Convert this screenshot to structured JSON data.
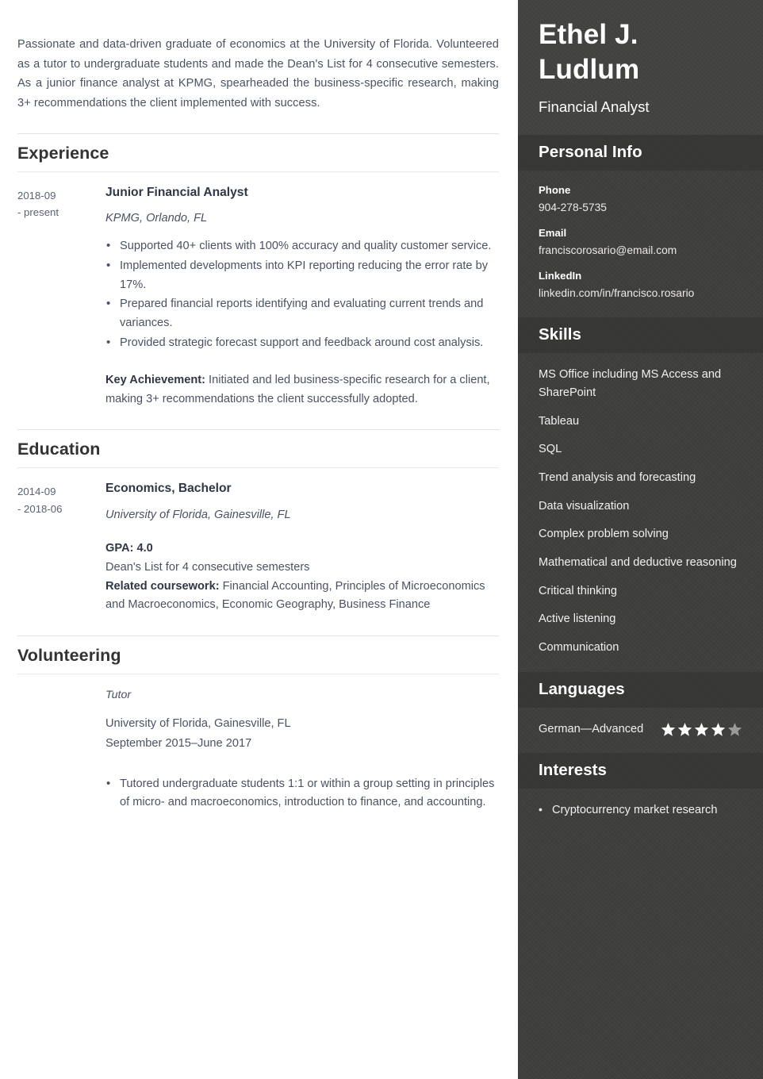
{
  "colors": {
    "sidebar_bg": "#3f3f3d",
    "sidebar_top_bg": "#434341",
    "sidebar_header_bg": "#373735",
    "body_text": "#4a5263",
    "heading_text": "#333333",
    "star_filled": "#ffffff",
    "star_empty": "#9a9a9a"
  },
  "main": {
    "summary": "Passionate and data-driven graduate of economics at the University of Florida. Volunteered as a tutor to undergraduate students and made the Dean's List for 4 consecutive semesters. As a junior finance analyst at KPMG, spearheaded the business-specific research, making 3+ recommendations the client implemented with success.",
    "sections": {
      "experience": {
        "heading": "Experience",
        "entries": [
          {
            "date_start": "2018-09",
            "date_end": "- present",
            "title": "Junior Financial Analyst",
            "subtitle": "KPMG, Orlando, FL",
            "bullets": [
              "Supported 40+ clients with 100% accuracy and quality customer service.",
              "Implemented developments into KPI reporting reducing the error rate by 17%.",
              "Prepared financial reports identifying and evaluating current trends and variances.",
              "Provided strategic forecast support and feedback around cost analysis."
            ],
            "achievement_label": "Key Achievement:",
            "achievement_text": " Initiated and led business-specific research for a client, making 3+ recommendations the client successfully adopted."
          }
        ]
      },
      "education": {
        "heading": "Education",
        "entries": [
          {
            "date_start": "2014-09",
            "date_end": "- 2018-06",
            "title": "Economics, Bachelor",
            "subtitle": "University of Florida, Gainesville, FL",
            "gpa": "GPA: 4.0",
            "honors": "Dean's List for 4 consecutive semesters",
            "coursework_label": "Related coursework:",
            "coursework_text": " Financial Accounting, Principles of Microeconomics and Macroeconomics, Economic Geography, Business Finance"
          }
        ]
      },
      "volunteering": {
        "heading": "Volunteering",
        "entries": [
          {
            "role": "Tutor",
            "org": "University of Florida, Gainesville, FL",
            "period": "September 2015–June 2017",
            "bullets": [
              "Tutored undergraduate students 1:1 or within a group setting in principles of micro- and macroeconomics, introduction to finance, and accounting."
            ]
          }
        ]
      }
    }
  },
  "sidebar": {
    "name": "Ethel J. Ludlum",
    "job_title": "Financial Analyst",
    "personal_info": {
      "heading": "Personal Info",
      "items": [
        {
          "label": "Phone",
          "value": "904-278-5735"
        },
        {
          "label": "Email",
          "value": "franciscorosario@email.com"
        },
        {
          "label": "LinkedIn",
          "value": "linkedin.com/in/francisco.rosario"
        }
      ]
    },
    "skills": {
      "heading": "Skills",
      "items": [
        "MS Office including MS Access and SharePoint",
        "Tableau",
        "SQL",
        "Trend analysis and forecasting",
        "Data visualization",
        "Complex problem solving",
        "Mathematical and deductive reasoning",
        "Critical thinking",
        "Active listening",
        "Communication"
      ]
    },
    "languages": {
      "heading": "Languages",
      "items": [
        {
          "name": "German—Advanced",
          "rating": 4,
          "max_rating": 5
        }
      ]
    },
    "interests": {
      "heading": "Interests",
      "items": [
        "Cryptocurrency market research"
      ]
    }
  }
}
